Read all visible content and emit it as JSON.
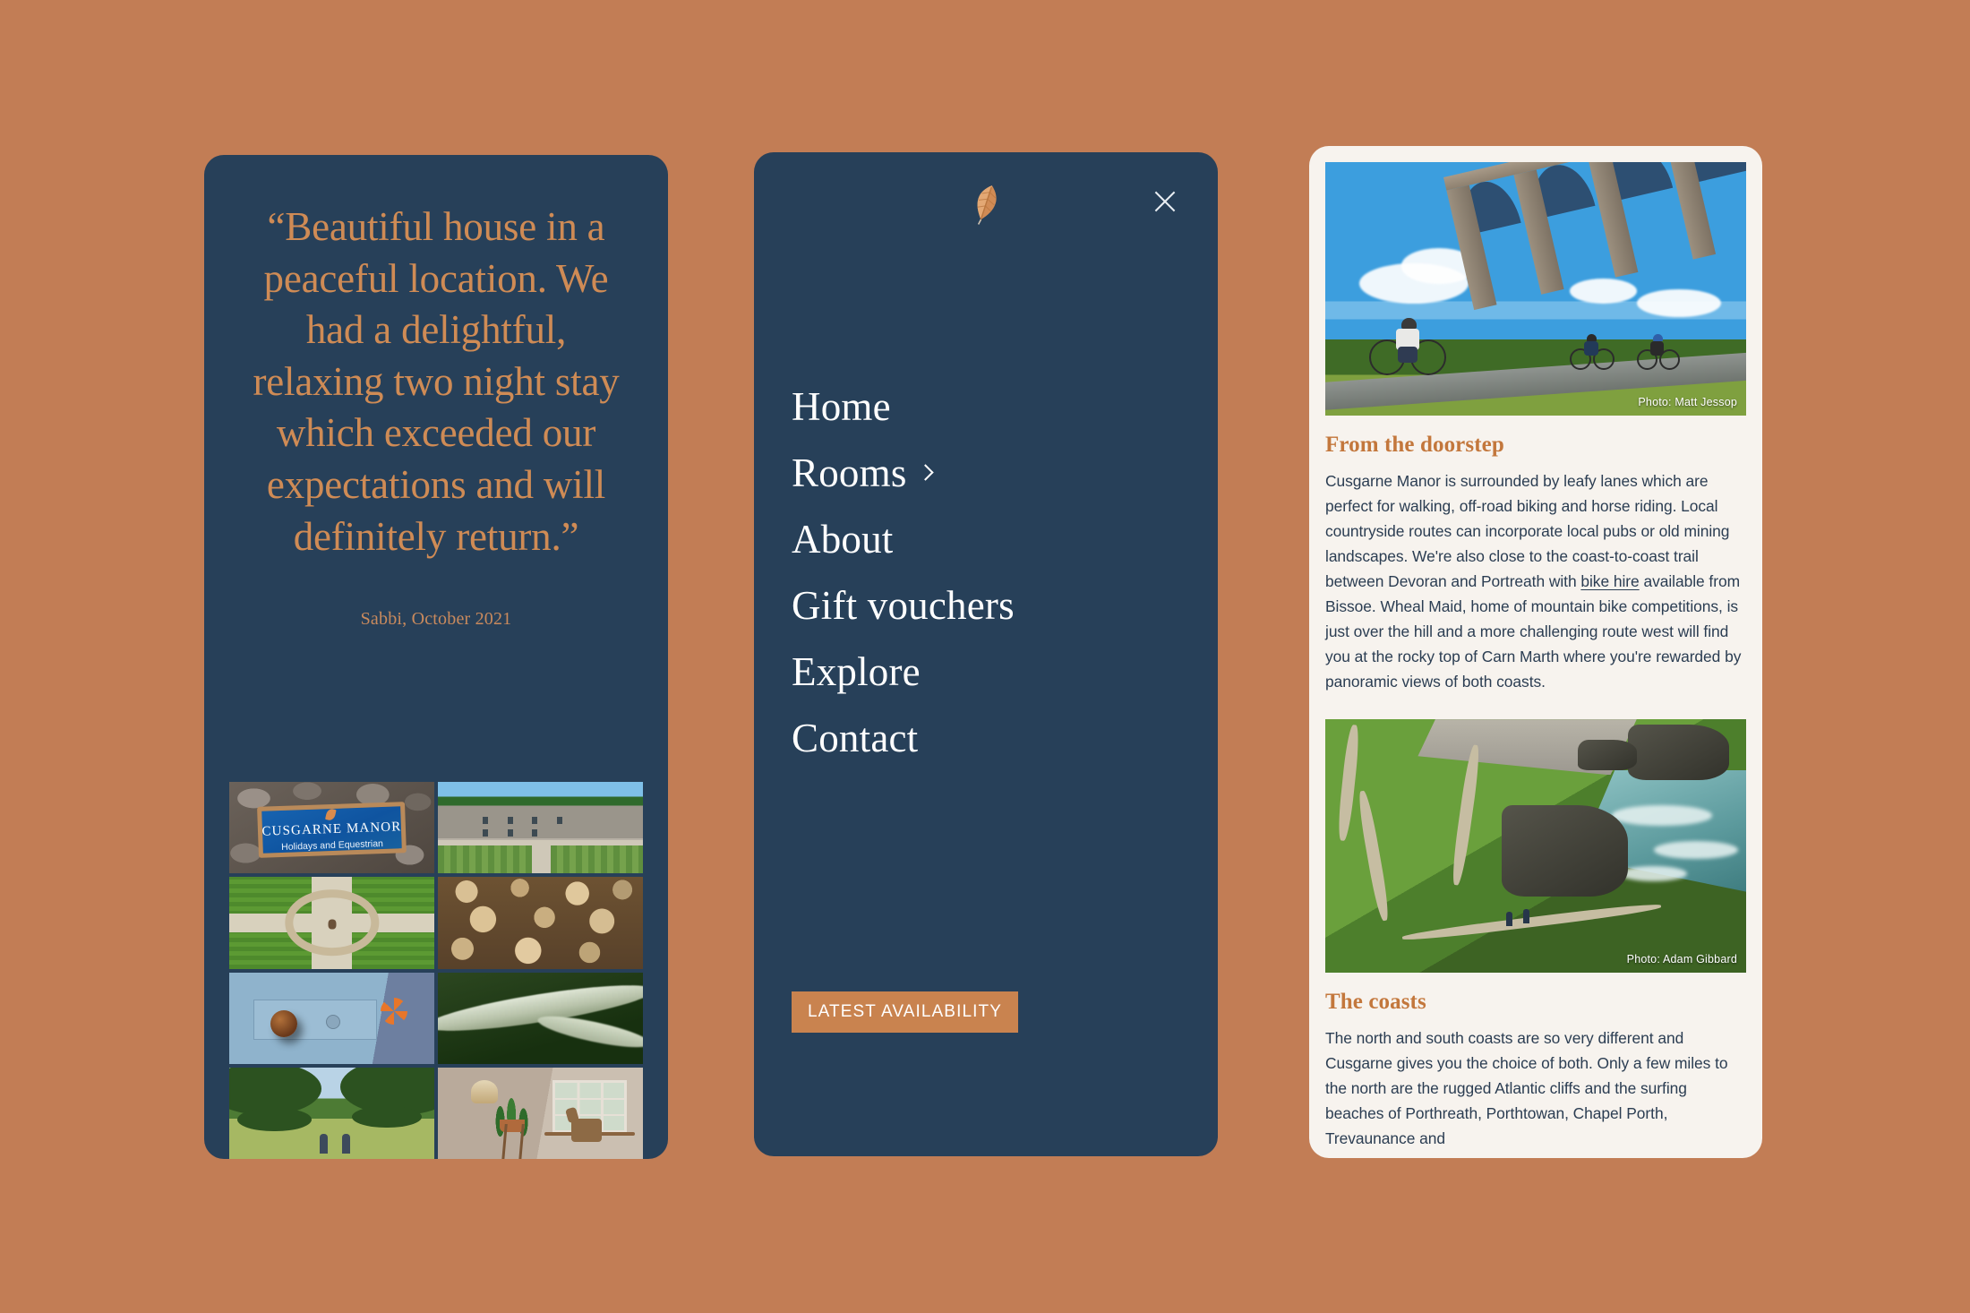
{
  "theme": {
    "background": "#c27d55",
    "panel_navy": "#274059",
    "panel_cream": "#f7f3ee",
    "accent_copper": "#c9834f",
    "quote_text": "#cf8b55",
    "heading_orange": "#c3773c",
    "body_navy": "#2b3d52"
  },
  "testimonial_panel": {
    "quote": "“Beautiful house in a peaceful location. We had a delightful, relaxing two night stay which exceeded our expectations and will definitely return.”",
    "attribution": "Sabbi, October 2021",
    "collage": [
      {
        "name": "manor-sign",
        "alt": "Cusgarne Manor sign on stone wall",
        "sign_title": "CUSGARNE MANOR",
        "sign_subtitle": "Holidays and Equestrian"
      },
      {
        "name": "manor-house",
        "alt": "Stone manor house with striped lawn"
      },
      {
        "name": "aerial-path",
        "alt": "Aerial view of cross-shaped gravel path in lawn"
      },
      {
        "name": "log-pile",
        "alt": "Stacked cut firewood logs"
      },
      {
        "name": "blue-door",
        "alt": "Blue painted door with brass knob and orange flower"
      },
      {
        "name": "lichen-branch",
        "alt": "Lichen covered tree branch"
      },
      {
        "name": "meadow-walkers",
        "alt": "Two people walking through a green meadow"
      },
      {
        "name": "interior-window",
        "alt": "Interior corner with plant and wooden horse on window sill"
      }
    ]
  },
  "menu_panel": {
    "logo": "oak-leaf-logo",
    "close_label": "Close menu",
    "items": [
      {
        "label": "Home",
        "has_submenu": false
      },
      {
        "label": "Rooms",
        "has_submenu": true
      },
      {
        "label": "About",
        "has_submenu": false
      },
      {
        "label": "Gift vouchers",
        "has_submenu": false
      },
      {
        "label": "Explore",
        "has_submenu": false
      },
      {
        "label": "Contact",
        "has_submenu": false
      }
    ],
    "cta_label": "LATEST AVAILABILITY"
  },
  "explore_panel": {
    "sections": [
      {
        "image": {
          "name": "viaduct-cyclists",
          "alt": "Cyclists riding a trail beneath a stone railway viaduct",
          "credit": "Photo: Matt Jessop"
        },
        "title": "From the doorstep",
        "body_before_link": "Cusgarne Manor is surrounded by leafy lanes which are perfect for walking, off-road biking and horse riding. Local countryside routes can incorporate local pubs or old mining landscapes. We're also close to the coast-to-coast trail between Devoran and Portreath with ",
        "link_text": "bike hire",
        "body_after_link": " available from Bissoe. Wheal Maid, home of mountain bike competitions, is just over the hill and a more challenging route west will find you at the rocky top of Carn Marth where you're rewarded by panoramic views of both coasts."
      },
      {
        "image": {
          "name": "coast-path-walkers",
          "alt": "Walkers on a coastal path above green cliffs and turquoise sea",
          "credit": "Photo: Adam Gibbard"
        },
        "title": "The coasts",
        "body_before_link": "The north and south coasts are so very different and Cusgarne gives you the choice of both. Only a few miles to the north are the rugged Atlantic cliffs and the surfing beaches of Porthreath, Porthtowan, Chapel Porth, Trevaunance and",
        "link_text": "",
        "body_after_link": ""
      }
    ]
  }
}
